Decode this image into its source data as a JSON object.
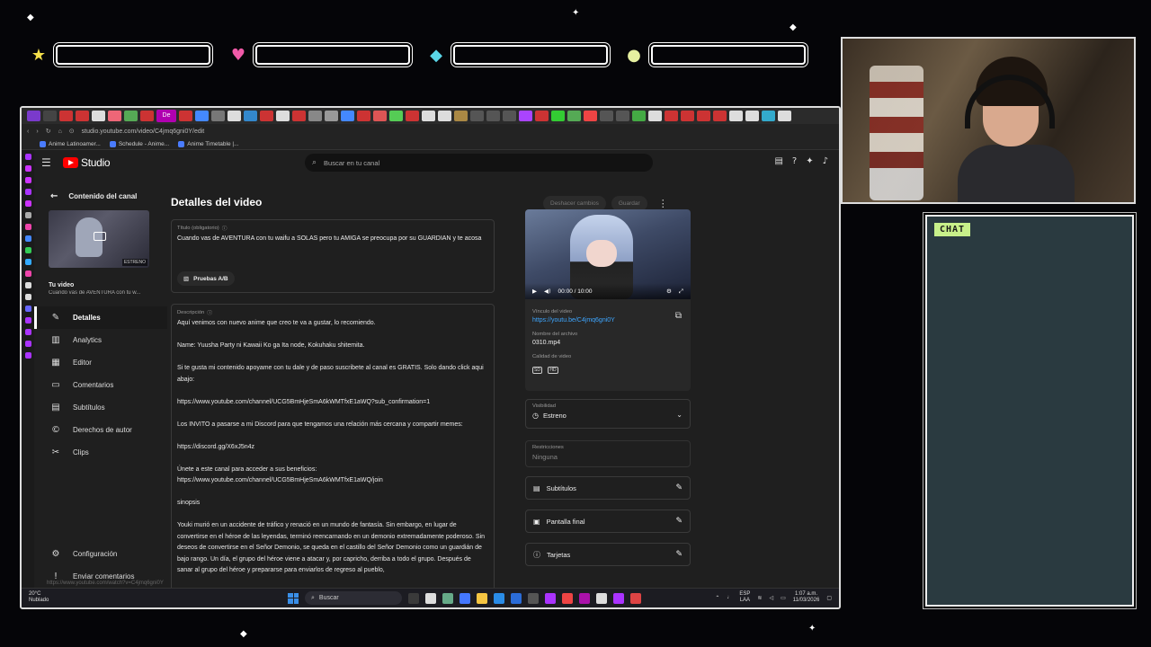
{
  "overlay": {
    "chat_title": "CHAT"
  },
  "browser": {
    "url": "studio.youtube.com/video/C4jmq6gni0Y/edit",
    "active_tab_label": "De",
    "bookmarks": [
      "Anime Latinoamer...",
      "Schedule - Anime...",
      "Anime Timetable |..."
    ]
  },
  "header": {
    "logo_text": "Studio",
    "search_placeholder": "Buscar en tu canal"
  },
  "sidebar": {
    "back_label": "Contenido del canal",
    "thumb_tag": "ESTRENO",
    "your_video_label": "Tu video",
    "your_video_title": "Cuando vas de AVENTURA con tu w...",
    "items": [
      {
        "label": "Detalles",
        "icon": "pencil-icon"
      },
      {
        "label": "Analytics",
        "icon": "analytics-icon"
      },
      {
        "label": "Editor",
        "icon": "editor-icon"
      },
      {
        "label": "Comentarios",
        "icon": "comments-icon"
      },
      {
        "label": "Subtítulos",
        "icon": "subtitles-icon"
      },
      {
        "label": "Derechos de autor",
        "icon": "copyright-icon"
      },
      {
        "label": "Clips",
        "icon": "scissors-icon"
      }
    ],
    "bottom": [
      {
        "label": "Configuración",
        "icon": "gear-icon"
      },
      {
        "label": "Enviar comentarios",
        "icon": "feedback-icon"
      }
    ]
  },
  "main": {
    "title": "Detalles del video",
    "undo_label": "Deshacer cambios",
    "save_label": "Guardar",
    "title_field": {
      "label": "Título (obligatorio)",
      "value": "Cuando vas de AVENTURA con tu waifu a SOLAS pero tu AMIGA se preocupa por su GUARDIAN y te acosa"
    },
    "ab_button": "Pruebas A/B",
    "description": {
      "label": "Descripción",
      "paragraphs": [
        "Aquí venimos con nuevo anime que creo te va a gustar, lo recomiendo.",
        "Name: Yuusha Party ni Kawaii Ko ga Ita node, Kokuhaku shitemita.",
        "Si te gusta mi contenido apoyame con tu dale y de paso suscribete al canal es GRATIS. Solo dando click aqui abajo:",
        "https://www.youtube.com/channel/UCG5BmHjeSmA6kWMTfxE1aWQ?sub_confirmation=1",
        "Los INVITO a pasarse a mi Discord para que tengamos una relación más cercana y compartir memes:",
        "https://discord.gg/X6xJ5n4z",
        "Únete a este canal para acceder a sus beneficios:\nhttps://www.youtube.com/channel/UCG5BmHjeSmA6kWMTfxE1aWQ/join",
        "sinopsis",
        "Youki murió en un accidente de tráfico y renació en un mundo de fantasía. Sin embargo, en lugar de convertirse en el héroe de las leyendas, terminó reencarnando en un demonio extremadamente poderoso. Sin deseos de convertirse en el Señor Demonio, se queda en el castillo del Señor Demonio como un guardián de bajo rango. Un día, el grupo del héroe viene a atacar y, por capricho, derriba a todo el grupo. Después de sanar al grupo del héroe y prepararse para enviarlos de regreso al pueblo,"
      ]
    },
    "video": {
      "time": "00:00 / 10:00",
      "link_label": "Vínculo del video",
      "link": "https://youtu.be/C4jmq6gni0Y",
      "filename_label": "Nombre del archivo",
      "filename": "0310.mp4",
      "quality_label": "Calidad de video",
      "quality_badges": [
        "SD",
        "HD"
      ]
    },
    "visibility": {
      "label": "Visibilidad",
      "value": "Estreno"
    },
    "restrictions": {
      "label": "Restricciones",
      "value": "Ninguna"
    },
    "rows": [
      {
        "label": "Subtítulos",
        "icon": "subtitles-icon"
      },
      {
        "label": "Pantalla final",
        "icon": "end-screen-icon"
      },
      {
        "label": "Tarjetas",
        "icon": "info-icon"
      }
    ]
  },
  "status_url": "https://www.youtube.com/watch?v=C4jmq6gni0Y",
  "taskbar": {
    "temp": "20°C",
    "weather": "Nublado",
    "search_label": "Buscar",
    "lang_top": "ESP",
    "lang_bottom": "LAA",
    "time": "1:07 a.m.",
    "date": "11/03/2026"
  }
}
